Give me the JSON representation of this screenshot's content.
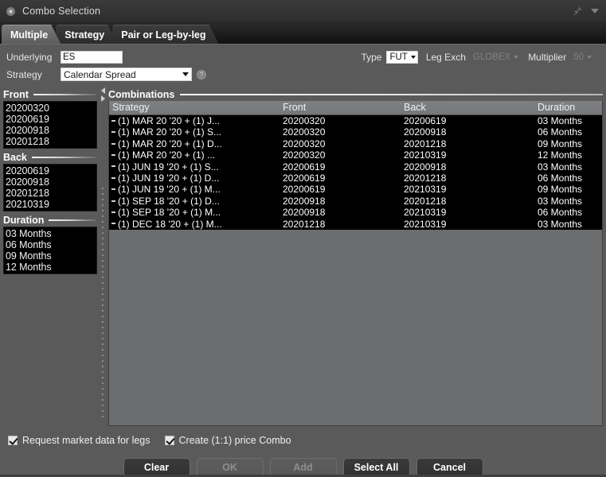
{
  "titlebar": {
    "title": "Combo Selection",
    "app_icon": "circle-icon",
    "pin_icon": "pin-icon",
    "menu_icon": "chevron-down-icon"
  },
  "tabs": [
    {
      "label": "Multiple",
      "active": true
    },
    {
      "label": "Strategy",
      "active": false
    },
    {
      "label": "Pair or Leg-by-leg",
      "active": false
    }
  ],
  "form": {
    "underlying_label": "Underlying",
    "underlying_value": "ES",
    "strategy_label": "Strategy",
    "strategy_value": "Calendar Spread",
    "help_icon": "question-mark-icon",
    "type_label": "Type",
    "type_value": "FUT",
    "leg_exch_label": "Leg Exch",
    "leg_exch_value": "GLOBEX",
    "multiplier_label": "Multiplier",
    "multiplier_value": "50"
  },
  "left_panel": {
    "front": {
      "title": "Front",
      "items": [
        "20200320",
        "20200619",
        "20200918",
        "20201218"
      ]
    },
    "back": {
      "title": "Back",
      "items": [
        "20200619",
        "20200918",
        "20201218",
        "20210319"
      ]
    },
    "duration": {
      "title": "Duration",
      "items": [
        "03 Months",
        "06 Months",
        "09 Months",
        "12 Months"
      ]
    }
  },
  "splitter": {
    "collapse_left_icon": "triangle-left-icon",
    "expand_right_icon": "triangle-right-icon",
    "grip_icon": "drag-grip-icon"
  },
  "combinations": {
    "title": "Combinations",
    "columns": [
      "Strategy",
      "Front",
      "Back",
      "Duration"
    ],
    "rows": [
      {
        "strategy": "(1) MAR 20 '20 + (1) J...",
        "front": "20200320",
        "back": "20200619",
        "duration": "03 Months"
      },
      {
        "strategy": "(1) MAR 20 '20 + (1) S...",
        "front": "20200320",
        "back": "20200918",
        "duration": "06 Months"
      },
      {
        "strategy": "(1) MAR 20 '20 + (1) D...",
        "front": "20200320",
        "back": "20201218",
        "duration": "09 Months"
      },
      {
        "strategy": "(1) MAR 20 '20 + (1) ...",
        "front": "20200320",
        "back": "20210319",
        "duration": "12 Months"
      },
      {
        "strategy": "(1) JUN 19 '20 + (1) S...",
        "front": "20200619",
        "back": "20200918",
        "duration": "03 Months"
      },
      {
        "strategy": "(1) JUN 19 '20 + (1) D...",
        "front": "20200619",
        "back": "20201218",
        "duration": "06 Months"
      },
      {
        "strategy": "(1) JUN 19 '20 + (1) M...",
        "front": "20200619",
        "back": "20210319",
        "duration": "09 Months"
      },
      {
        "strategy": "(1) SEP 18 '20 + (1) D...",
        "front": "20200918",
        "back": "20201218",
        "duration": "03 Months"
      },
      {
        "strategy": "(1) SEP 18 '20 + (1) M...",
        "front": "20200918",
        "back": "20210319",
        "duration": "06 Months"
      },
      {
        "strategy": "(1) DEC 18 '20 + (1) M...",
        "front": "20201218",
        "back": "20210319",
        "duration": "03 Months"
      }
    ]
  },
  "footer": {
    "checkbox_market_data": "Request market data for legs",
    "checkbox_price_combo": "Create (1:1) price Combo",
    "buttons": [
      {
        "label": "Clear",
        "disabled": false
      },
      {
        "label": "OK",
        "disabled": true
      },
      {
        "label": "Add",
        "disabled": true
      },
      {
        "label": "Select All",
        "disabled": false
      },
      {
        "label": "Cancel",
        "disabled": false
      }
    ]
  },
  "colors": {
    "window_bg": "#5a5a5a",
    "list_bg": "#000000",
    "grid_header": "#76787b",
    "text_primary": "#ffffff",
    "titlebar_bg": "#333333"
  }
}
